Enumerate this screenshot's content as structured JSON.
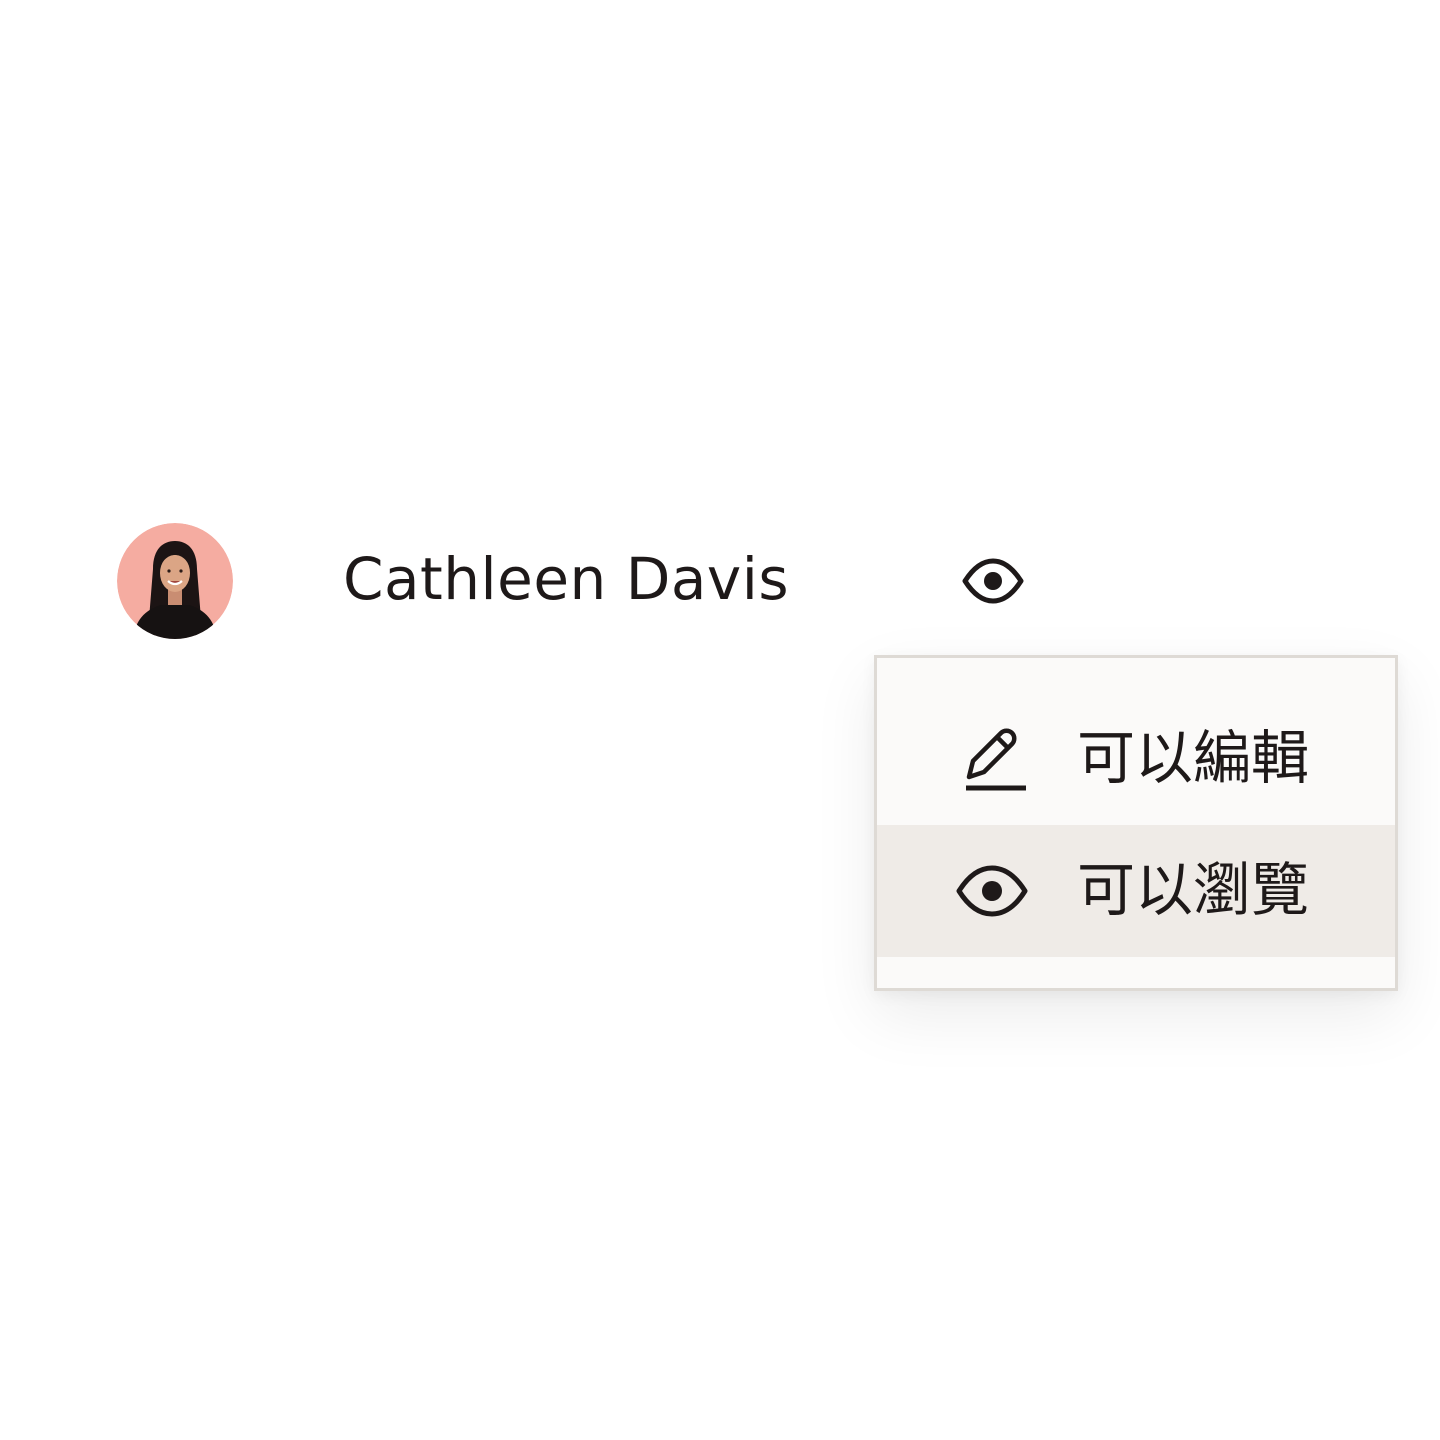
{
  "share": {
    "user": {
      "name": "Cathleen Davis",
      "avatar_bg": "#f5aca1"
    },
    "current_permission_icon": "eye-icon"
  },
  "permission_menu": {
    "items": [
      {
        "label": "可以編輯",
        "icon": "pencil-icon",
        "selected": false
      },
      {
        "label": "可以瀏覽",
        "icon": "eye-icon",
        "selected": true
      }
    ],
    "selected_bg": "#efebe7",
    "menu_bg": "#fbfaf9"
  },
  "colors": {
    "text": "#1e1919"
  }
}
